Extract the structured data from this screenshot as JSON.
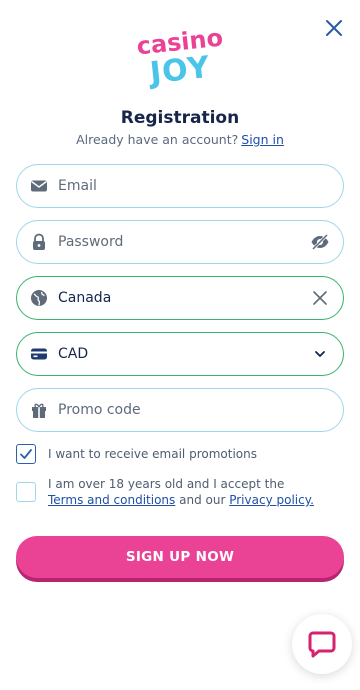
{
  "brand": {
    "logo_top": "casino",
    "logo_bottom": "JOY",
    "colors": {
      "pink": "#ea4396",
      "cyan": "#4bc4ea",
      "navy": "#16264a",
      "link": "#1f4fa8"
    }
  },
  "header": {
    "close_icon": "close-icon",
    "title": "Registration",
    "subtitle_text": "Already have an account?",
    "signin_link": "Sign in"
  },
  "form": {
    "email": {
      "placeholder": "Email",
      "icon": "envelope-icon"
    },
    "password": {
      "placeholder": "Password",
      "icon": "lock-icon",
      "toggle_icon": "eye-slash-icon"
    },
    "country": {
      "value": "Canada",
      "icon": "globe-icon",
      "clear_icon": "close-icon"
    },
    "currency": {
      "value": "CAD",
      "icon": "wallet-icon",
      "dropdown_icon": "chevron-down-icon"
    },
    "promo": {
      "placeholder": "Promo code",
      "icon": "gift-icon"
    }
  },
  "consents": {
    "email_promotions": {
      "label": "I want to receive email promotions",
      "checked": true
    },
    "terms": {
      "label_part1": "I am over 18 years old and I accept the",
      "terms_link": "Terms and conditions",
      "label_part2": "and our",
      "privacy_link": "Privacy policy.",
      "checked": false
    }
  },
  "actions": {
    "signup_label": "SIGN UP NOW"
  },
  "support": {
    "chat_icon": "chat-bubble-icon"
  }
}
